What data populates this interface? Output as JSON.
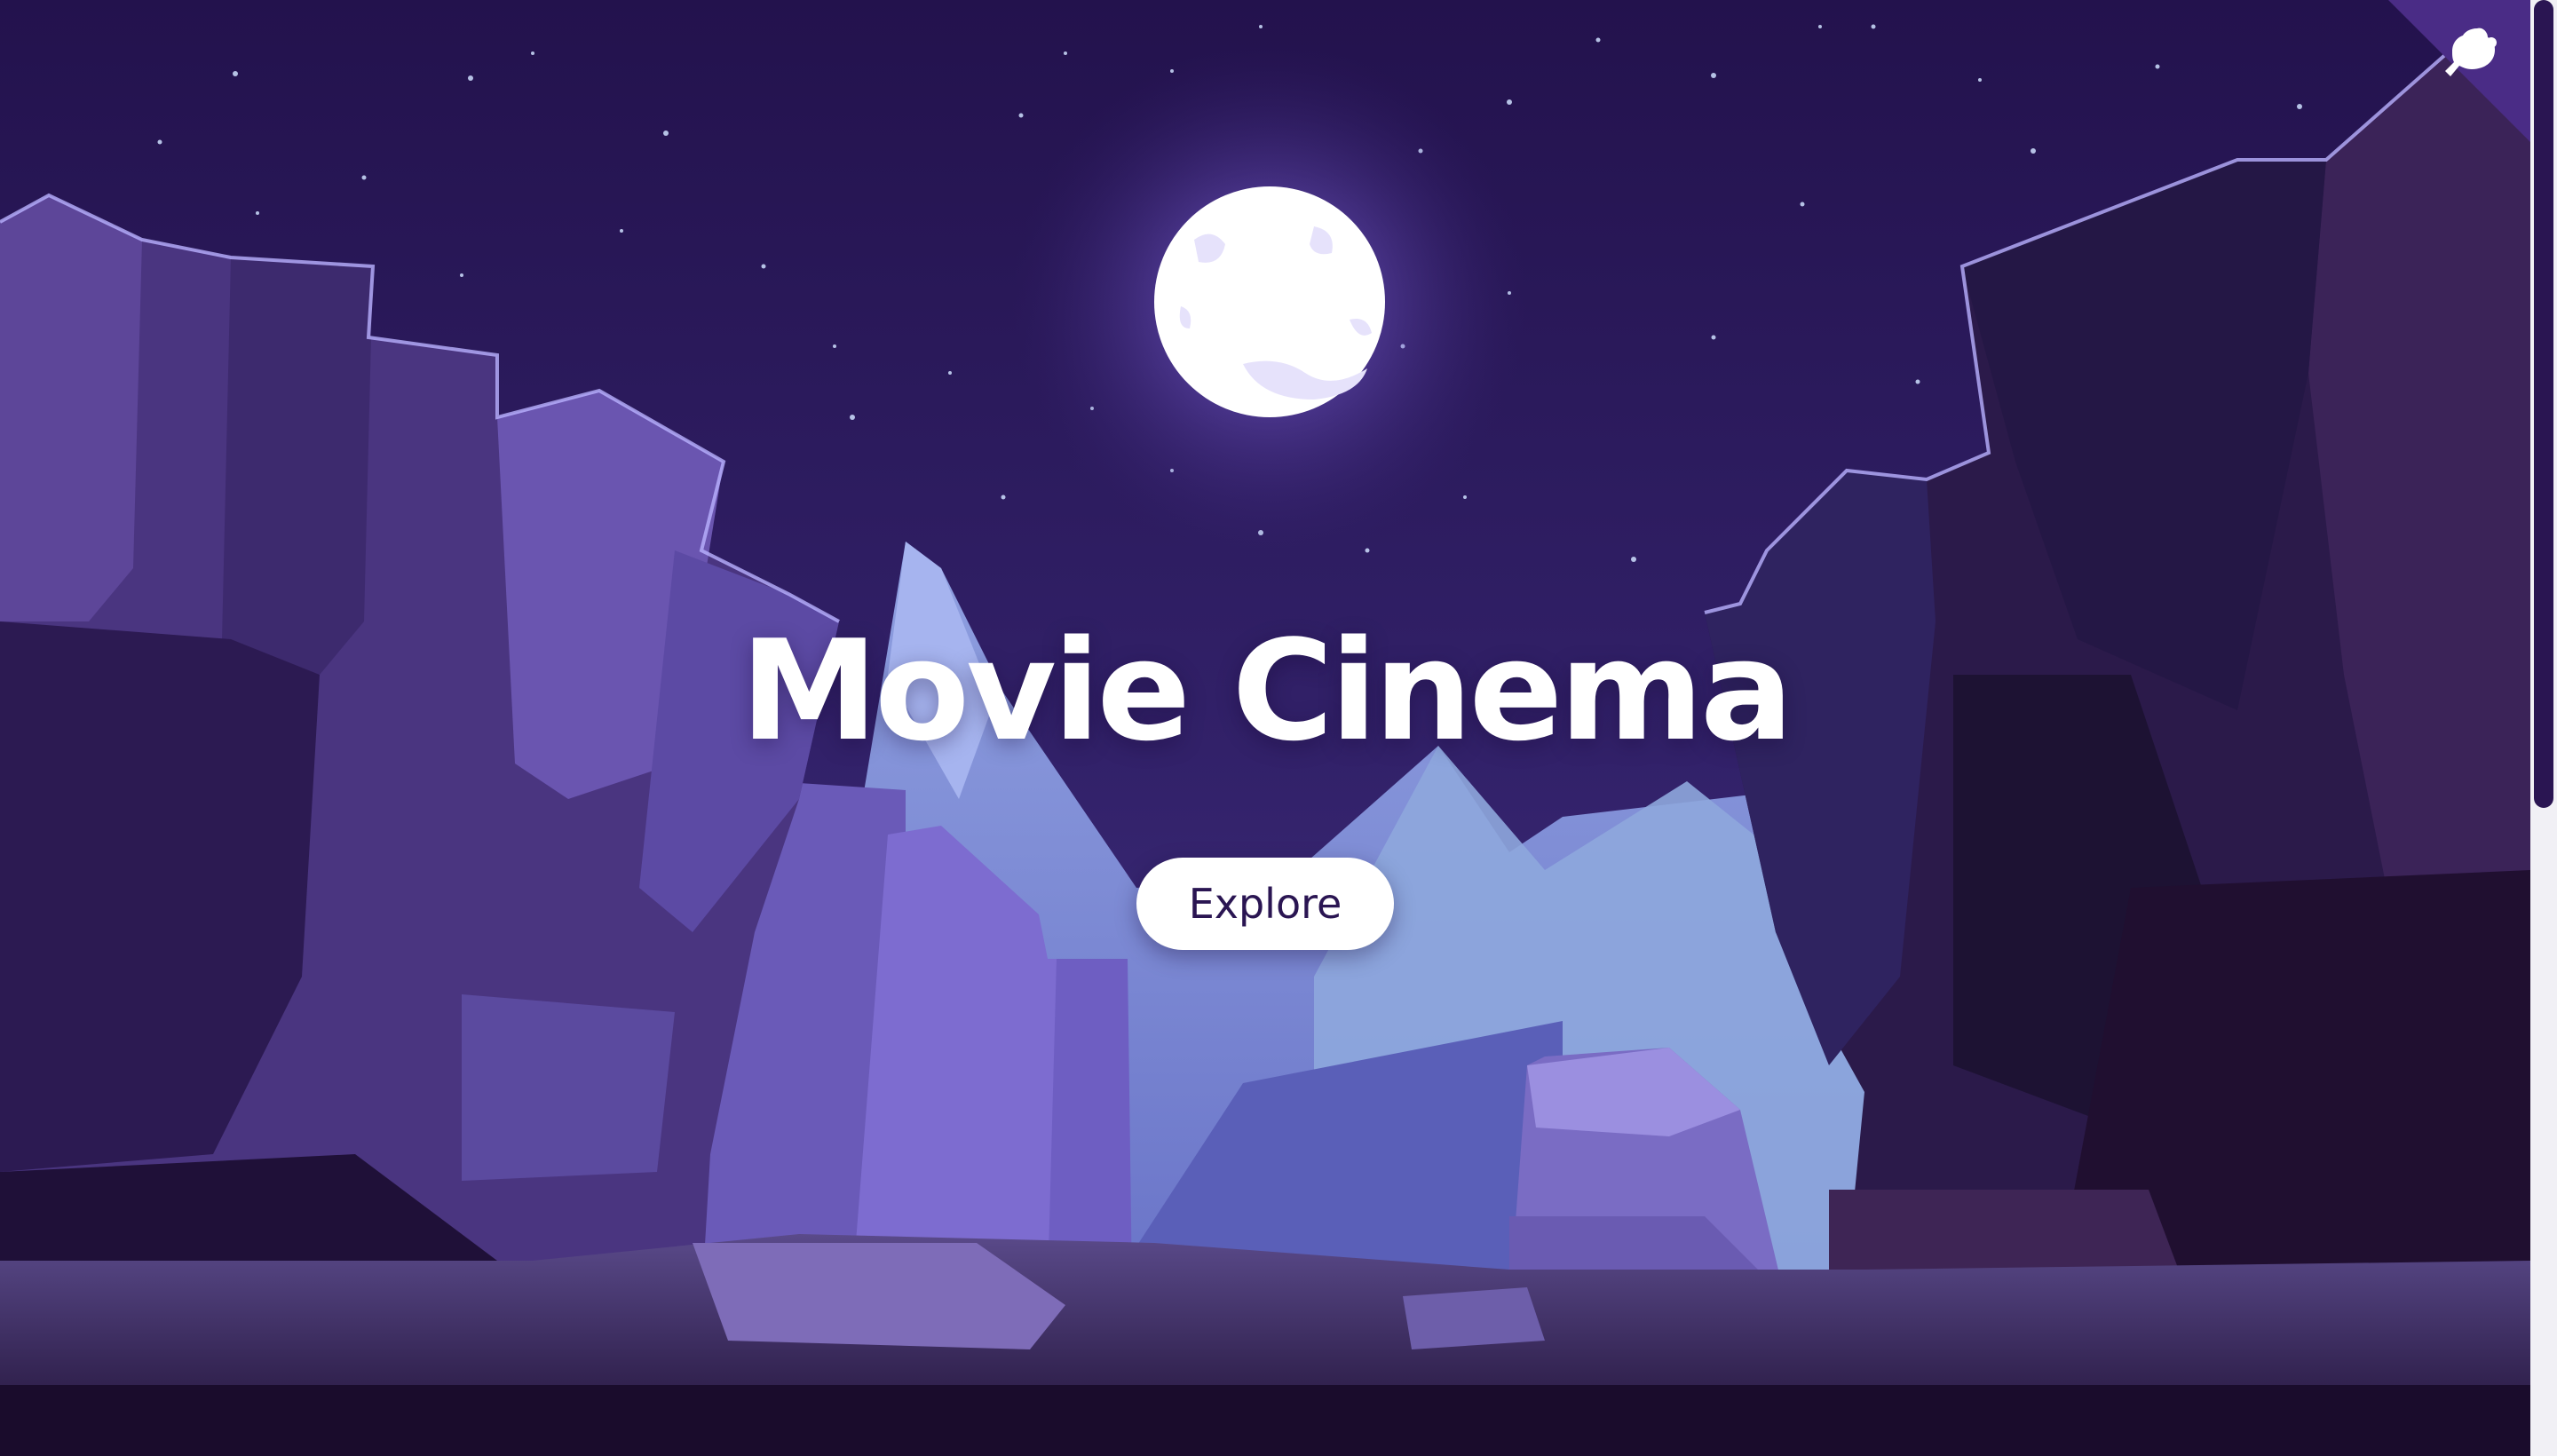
{
  "hero": {
    "title": "Movie Cinema",
    "explore_label": "Explore"
  },
  "corner_badge": {
    "icon": "github-cat-icon",
    "color": "#4a2c86"
  },
  "colors": {
    "sky_top": "#24124f",
    "sky_bottom": "#3d2a78",
    "moon": "#ffffff",
    "mountain_light": "#7b8fd4",
    "rock_dark": "#2a1747",
    "button_text": "#2a1552",
    "scrollbar_thumb": "#2a1552"
  }
}
